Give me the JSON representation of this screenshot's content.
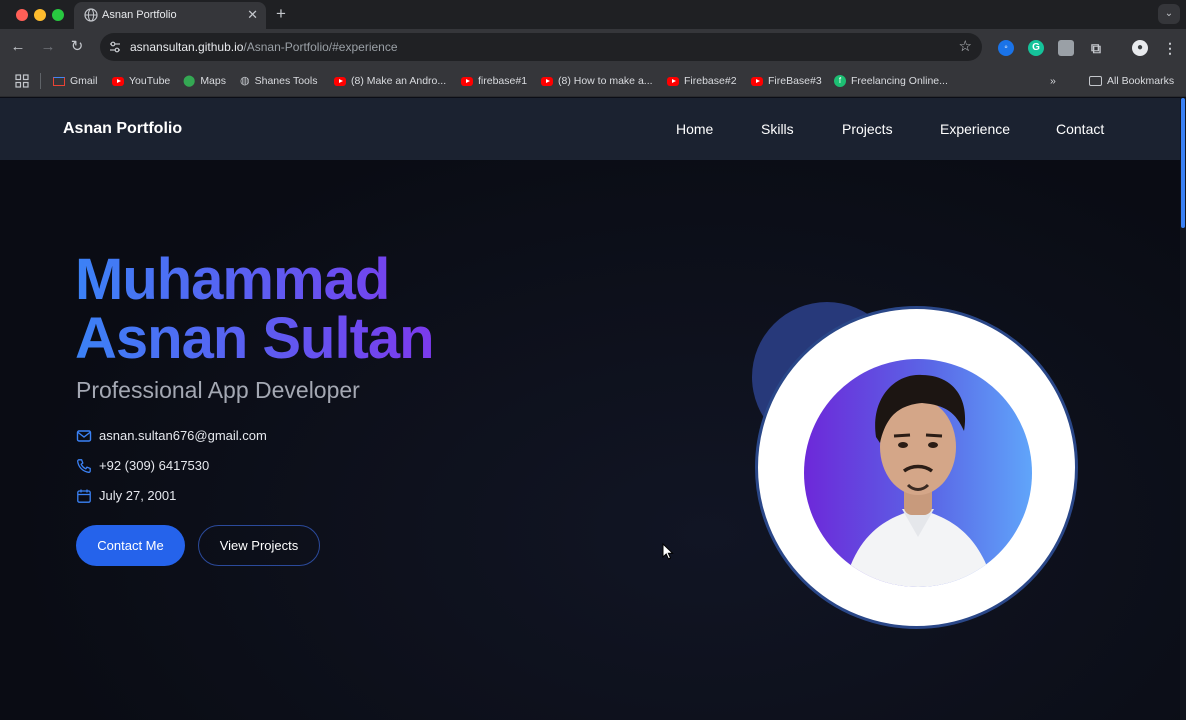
{
  "browser": {
    "tab_title": "Asnan Portfolio",
    "url_host": "asnansultan.github.io",
    "url_path": "/Asnan-Portfolio/#experience",
    "bookmarks": [
      {
        "label": "Gmail",
        "icon": "gmail-icon"
      },
      {
        "label": "YouTube",
        "icon": "youtube-icon"
      },
      {
        "label": "Maps",
        "icon": "maps-icon"
      },
      {
        "label": "Shanes Tools",
        "icon": "globe-icon"
      },
      {
        "label": "(8) Make an Andro...",
        "icon": "youtube-icon"
      },
      {
        "label": "firebase#1",
        "icon": "youtube-icon"
      },
      {
        "label": "(8) How to make a...",
        "icon": "youtube-icon"
      },
      {
        "label": "Firebase#2",
        "icon": "youtube-icon"
      },
      {
        "label": "FireBase#3",
        "icon": "youtube-icon"
      },
      {
        "label": "Freelancing Online...",
        "icon": "green-f-icon"
      }
    ],
    "all_bookmarks": "All Bookmarks"
  },
  "site": {
    "brand": "Asnan Portfolio",
    "nav": [
      "Home",
      "Skills",
      "Projects",
      "Experience",
      "Contact"
    ],
    "hero": {
      "name_line1": "Muhammad",
      "name_line2": "Asnan Sultan",
      "role": "Professional App Developer",
      "email": "asnan.sultan676@gmail.com",
      "phone": "+92 (309) 6417530",
      "dob": "July 27, 2001",
      "primary_button": "Contact Me",
      "secondary_button": "View Projects"
    }
  },
  "colors": {
    "accent": "#2563eb",
    "gradient_start": "#3b82f6",
    "gradient_end": "#7c3aed",
    "nav_bg": "#1b2230",
    "page_bg": "#0b0d16"
  }
}
